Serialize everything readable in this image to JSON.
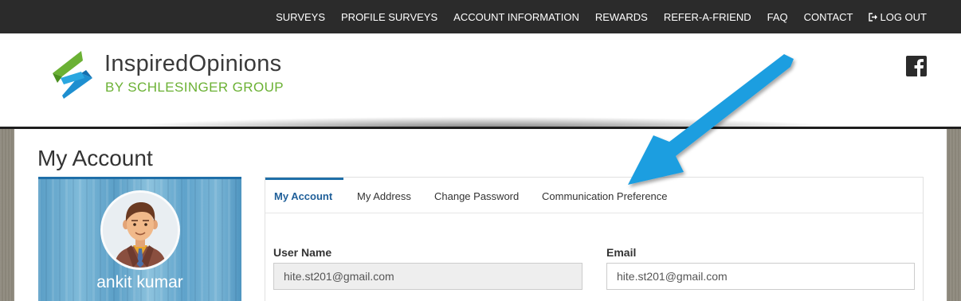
{
  "nav": {
    "items": [
      "SURVEYS",
      "PROFILE SURVEYS",
      "ACCOUNT INFORMATION",
      "REWARDS",
      "REFER-A-FRIEND",
      "FAQ",
      "CONTACT"
    ],
    "logout_label": "LOG OUT"
  },
  "brand": {
    "name": "InspiredOpinions",
    "tagline": "BY SCHLESINGER GROUP",
    "colors": {
      "green": "#6bb134",
      "blue": "#1e8fd0",
      "text": "#3a3a3a"
    }
  },
  "social": {
    "icon": "facebook-icon"
  },
  "page": {
    "title": "My Account"
  },
  "profile": {
    "name": "ankit kumar",
    "avatar_icon": "user-avatar"
  },
  "tabs": [
    "My Account",
    "My Address",
    "Change Password",
    "Communication Preference"
  ],
  "active_tab": "My Account",
  "form": {
    "username_label": "User Name",
    "username_value": "hite.st201@gmail.com",
    "email_label": "Email",
    "email_value": "hite.st201@gmail.com"
  },
  "annotation": {
    "type": "arrow",
    "color": "#1e9ee0",
    "points_to": "Communication Preference"
  }
}
